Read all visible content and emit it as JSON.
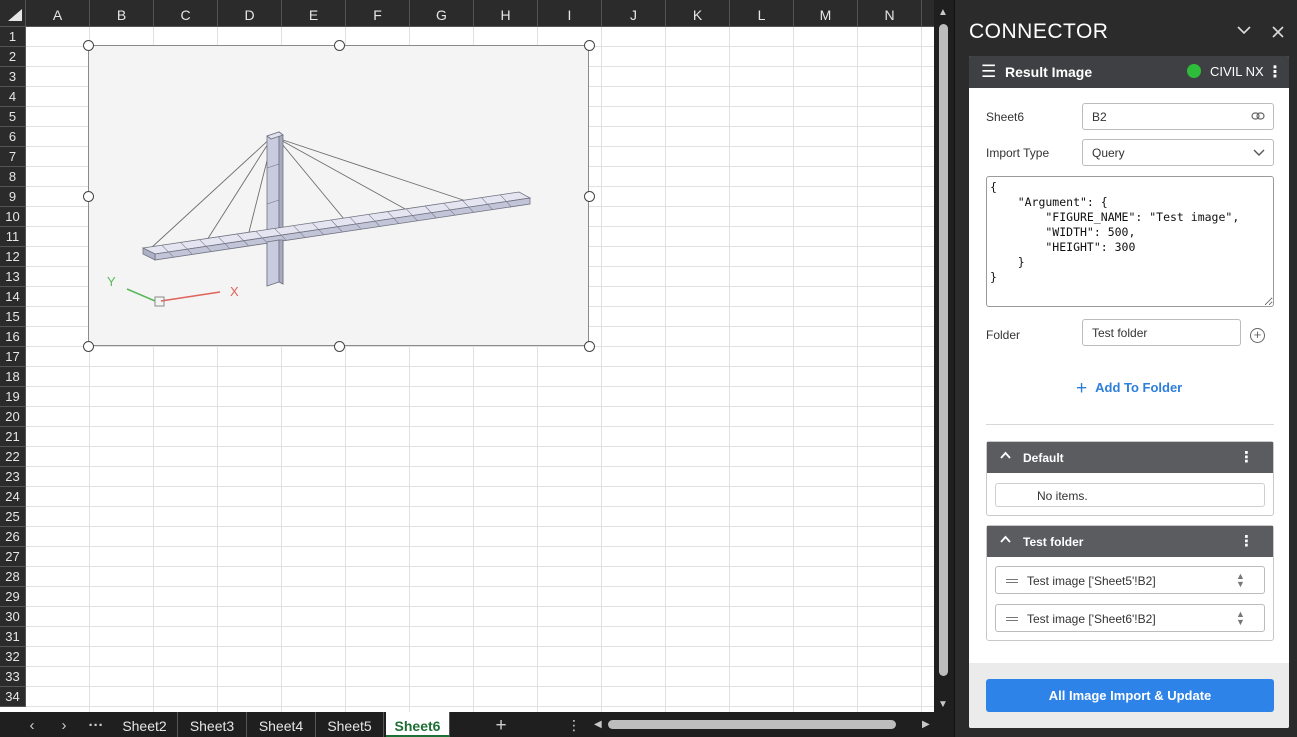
{
  "sheet": {
    "columns": [
      "A",
      "B",
      "C",
      "D",
      "E",
      "F",
      "G",
      "H",
      "I",
      "J",
      "K",
      "L",
      "M",
      "N"
    ],
    "rows": [
      "1",
      "2",
      "3",
      "4",
      "5",
      "6",
      "7",
      "8",
      "9",
      "10",
      "11",
      "12",
      "13",
      "14",
      "15",
      "16",
      "17",
      "18",
      "19",
      "20",
      "21",
      "22",
      "23",
      "24",
      "25",
      "26",
      "27",
      "28",
      "29",
      "30",
      "31",
      "32",
      "33",
      "34"
    ],
    "picture": {
      "axis_y_label": "Y",
      "axis_x_label": "X"
    }
  },
  "tabbar": {
    "prev_icon": "chevron-left-icon",
    "next_icon": "chevron-right-icon",
    "more": "···",
    "tabs": [
      "Sheet2",
      "Sheet3",
      "Sheet4",
      "Sheet5",
      "Sheet6"
    ],
    "active_tab": "Sheet6",
    "add": "+",
    "options": "⋮"
  },
  "panel": {
    "title": "CONNECTOR",
    "collapse_icon": "chevron-down-icon",
    "close_icon": "close-icon",
    "card": {
      "title": "Result Image",
      "product": "CIVIL NX",
      "status_color": "#2ebd3b",
      "sheet_label": "Sheet6",
      "cell_value": "B2",
      "import_type_label": "Import Type",
      "import_type_value": "Query",
      "json_text": "{\n    \"Argument\": {\n        \"FIGURE_NAME\": \"Test image\",\n        \"WIDTH\": 500,\n        \"HEIGHT\": 300\n    }\n}",
      "folder_label": "Folder",
      "folder_value": "Test folder",
      "add_to_folder": "Add To Folder",
      "folders": [
        {
          "name": "Default",
          "empty_text": "No items."
        },
        {
          "name": "Test folder",
          "items": [
            "Test image ['Sheet5'!B2]",
            "Test image ['Sheet6'!B2]"
          ]
        }
      ],
      "import_button": "All Image Import & Update",
      "accent": "#2d83e8"
    }
  }
}
